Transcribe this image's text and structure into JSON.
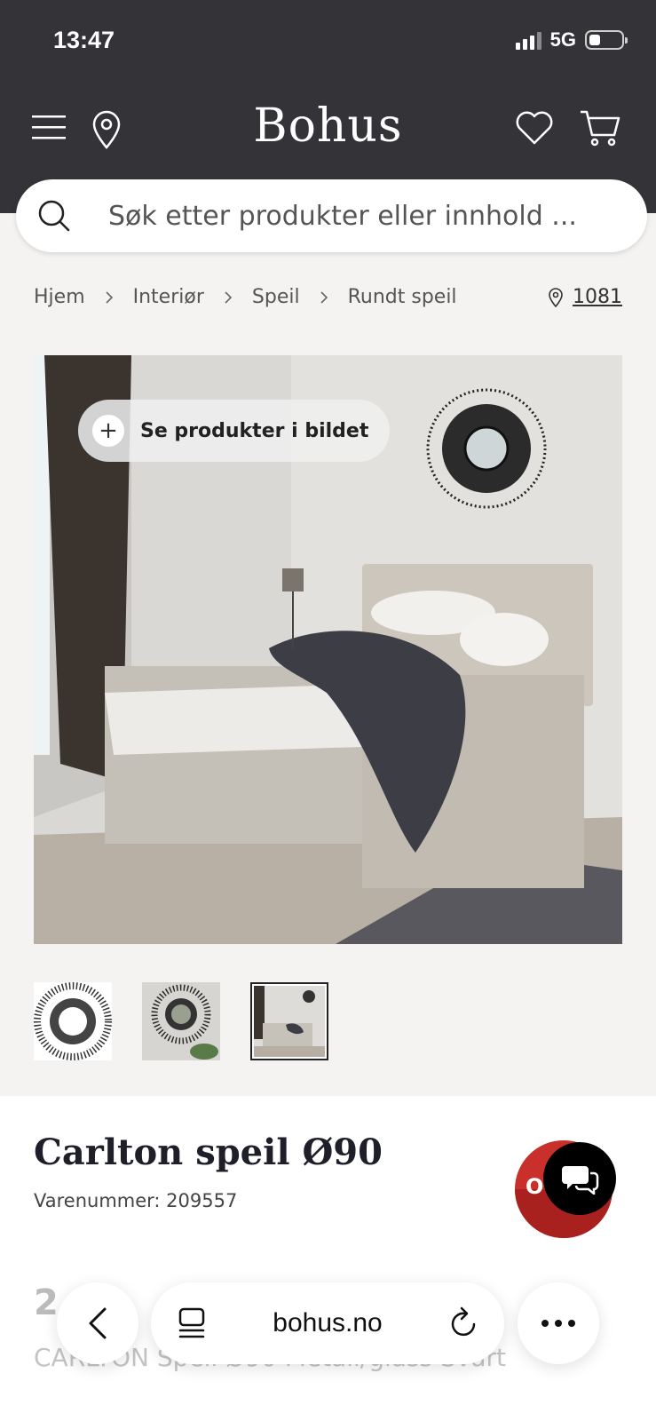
{
  "status_bar": {
    "time": "13:47",
    "network": "5G"
  },
  "header": {
    "logo": "Bohus"
  },
  "search": {
    "placeholder": "Søk etter produkter eller innhold ..."
  },
  "breadcrumb": {
    "items": [
      "Hjem",
      "Interiør",
      "Speil",
      "Rundt speil"
    ],
    "store": "1081"
  },
  "hero": {
    "overlay_button": "Se produkter i bildet"
  },
  "thumbnails": {
    "count": 3,
    "active_index": 2
  },
  "product": {
    "title": "Carlton speil Ø90",
    "sku": "Varenummer: 209557",
    "price_partial": "2 4",
    "description": "CARLTON Speil Ø90 Metall/glass Svart"
  },
  "badge": {
    "text": "O"
  },
  "browser": {
    "url": "bohus.no"
  },
  "colors": {
    "header_bg": "#333338",
    "page_bg": "#f4f3f1",
    "badge_red": "#c9302c"
  }
}
